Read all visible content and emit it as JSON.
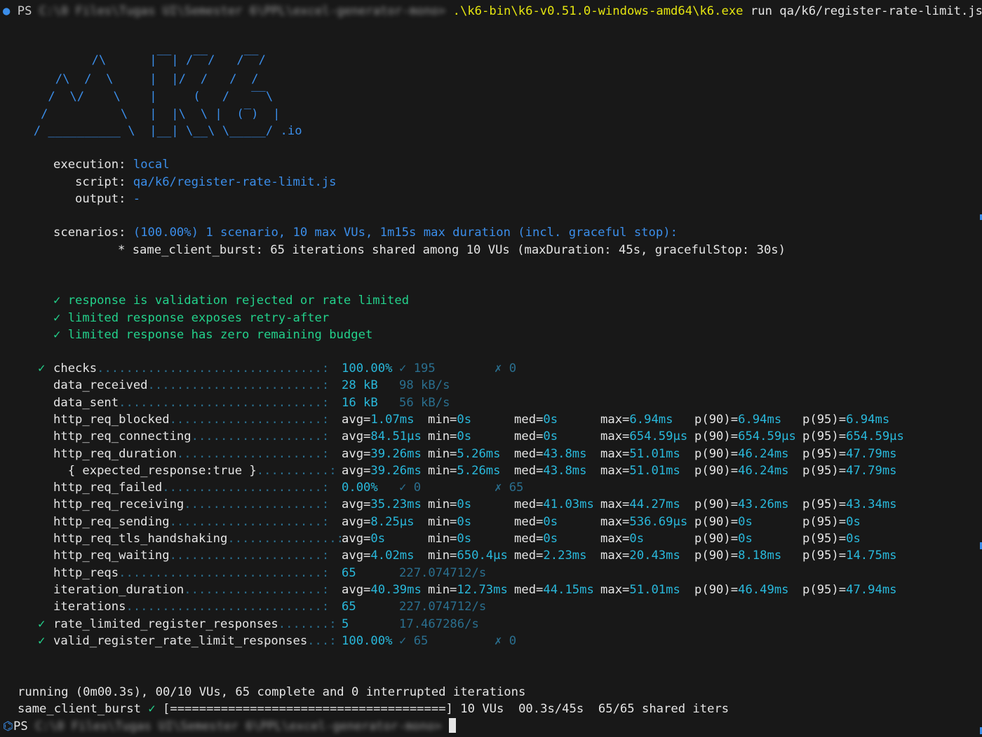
{
  "prompt": {
    "dot": "●",
    "ps": "PS",
    "blurred_path": "C:\\0 Files\\Tugas UI\\Semester 6\\PPL\\excel-generator-mono>",
    "exe": ".\\k6-bin\\k6-v0.51.0-windows-amd64\\k6.exe",
    "args": "run qa/k6/register-rate-limit.js"
  },
  "logo": {
    "lines": [
      "          /\\      |‾‾| /‾‾/   /‾‾/",
      "     /\\  /  \\     |  |/  /   /  /",
      "    /  \\/    \\    |     (   /   ‾‾\\",
      "   /          \\   |  |\\  \\ |  (‾)  |",
      "  / __________ \\  |__| \\__\\ \\_____/ .io"
    ]
  },
  "execution": {
    "execution_label": "execution:",
    "execution_value": "local",
    "script_label": "script:",
    "script_value": "qa/k6/register-rate-limit.js",
    "output_label": "output:",
    "output_value": "-",
    "scenarios_label": "scenarios:",
    "scenarios_value": "(100.00%) 1 scenario, 10 max VUs, 1m15s max duration (incl. graceful stop):",
    "scenario_detail": "* same_client_burst: 65 iterations shared among 10 VUs (maxDuration: 45s, gracefulStop: 30s)"
  },
  "checks_list": [
    "✓ response is validation rejected or rate limited",
    "✓ limited response exposes retry-after",
    "✓ limited response has zero remaining budget"
  ],
  "metrics": [
    {
      "mark": "✓",
      "name": "checks",
      "dots": "...............................:",
      "v1": "100.00%",
      "v2": "✓ 195",
      "v3": "✗ 0"
    },
    {
      "mark": "",
      "name": "data_received",
      "dots": "........................:",
      "v1": "28 kB",
      "v2": "98 kB/s"
    },
    {
      "mark": "",
      "name": "data_sent",
      "dots": "............................:",
      "v1": "16 kB",
      "v2": "56 kB/s"
    },
    {
      "mark": "",
      "name": "http_req_blocked",
      "dots": ".....................:",
      "avg": "1.07ms",
      "min": "0s",
      "med": "0s",
      "max": "6.94ms",
      "p90": "6.94ms",
      "p95": "6.94ms"
    },
    {
      "mark": "",
      "name": "http_req_connecting",
      "dots": "..................:",
      "avg": "84.51µs",
      "min": "0s",
      "med": "0s",
      "max": "654.59µs",
      "p90": "654.59µs",
      "p95": "654.59µs"
    },
    {
      "mark": "",
      "name": "http_req_duration",
      "dots": "....................:",
      "avg": "39.26ms",
      "min": "5.26ms",
      "med": "43.8ms",
      "max": "51.01ms",
      "p90": "46.24ms",
      "p95": "47.79ms"
    },
    {
      "mark": "",
      "name": "  { expected_response:true }",
      "dots": "..........:",
      "avg": "39.26ms",
      "min": "5.26ms",
      "med": "43.8ms",
      "max": "51.01ms",
      "p90": "46.24ms",
      "p95": "47.79ms"
    },
    {
      "mark": "",
      "name": "http_req_failed",
      "dots": "......................:",
      "v1": "0.00%",
      "v2": "✓ 0",
      "v3": "✗ 65"
    },
    {
      "mark": "",
      "name": "http_req_receiving",
      "dots": "...................:",
      "avg": "35.23ms",
      "min": "0s",
      "med": "41.03ms",
      "max": "44.27ms",
      "p90": "43.26ms",
      "p95": "43.34ms"
    },
    {
      "mark": "",
      "name": "http_req_sending",
      "dots": ".....................:",
      "avg": "8.25µs",
      "min": "0s",
      "med": "0s",
      "max": "536.69µs",
      "p90": "0s",
      "p95": "0s"
    },
    {
      "mark": "",
      "name": "http_req_tls_handshaking",
      "dots": "...............:",
      "avg": "0s",
      "min": "0s",
      "med": "0s",
      "max": "0s",
      "p90": "0s",
      "p95": "0s"
    },
    {
      "mark": "",
      "name": "http_req_waiting",
      "dots": ".....................:",
      "avg": "4.02ms",
      "min": "650.4µs",
      "med": "2.23ms",
      "max": "20.43ms",
      "p90": "8.18ms",
      "p95": "14.75ms"
    },
    {
      "mark": "",
      "name": "http_reqs",
      "dots": "............................:",
      "v1": "65",
      "v2": "227.074712/s"
    },
    {
      "mark": "",
      "name": "iteration_duration",
      "dots": "...................:",
      "avg": "40.39ms",
      "min": "12.73ms",
      "med": "44.15ms",
      "max": "51.01ms",
      "p90": "46.49ms",
      "p95": "47.94ms"
    },
    {
      "mark": "",
      "name": "iterations",
      "dots": "...........................:",
      "v1": "65",
      "v2": "227.074712/s"
    },
    {
      "mark": "✓",
      "name": "rate_limited_register_responses",
      "dots": ".......:",
      "v1": "5",
      "v2": "17.467286/s"
    },
    {
      "mark": "✓",
      "name": "valid_register_rate_limit_responses",
      "dots": "...:",
      "v1": "100.00%",
      "v2": "✓ 65",
      "v3": "✗ 0"
    }
  ],
  "summary": {
    "running": "running (0m00.3s), 00/10 VUs, 65 complete and 0 interrupted iterations",
    "burst_name": "same_client_burst",
    "burst_check": "✓",
    "burst_bar": "[======================================]",
    "burst_stats": "10 VUs  00.3s/45s  65/65 shared iters"
  },
  "prompt2": {
    "icon": "⌬",
    "ps": "PS",
    "blurred_path": "C:\\0 Files\\Tugas UI\\Semester 6\\PPL\\excel-generator-mono>"
  }
}
